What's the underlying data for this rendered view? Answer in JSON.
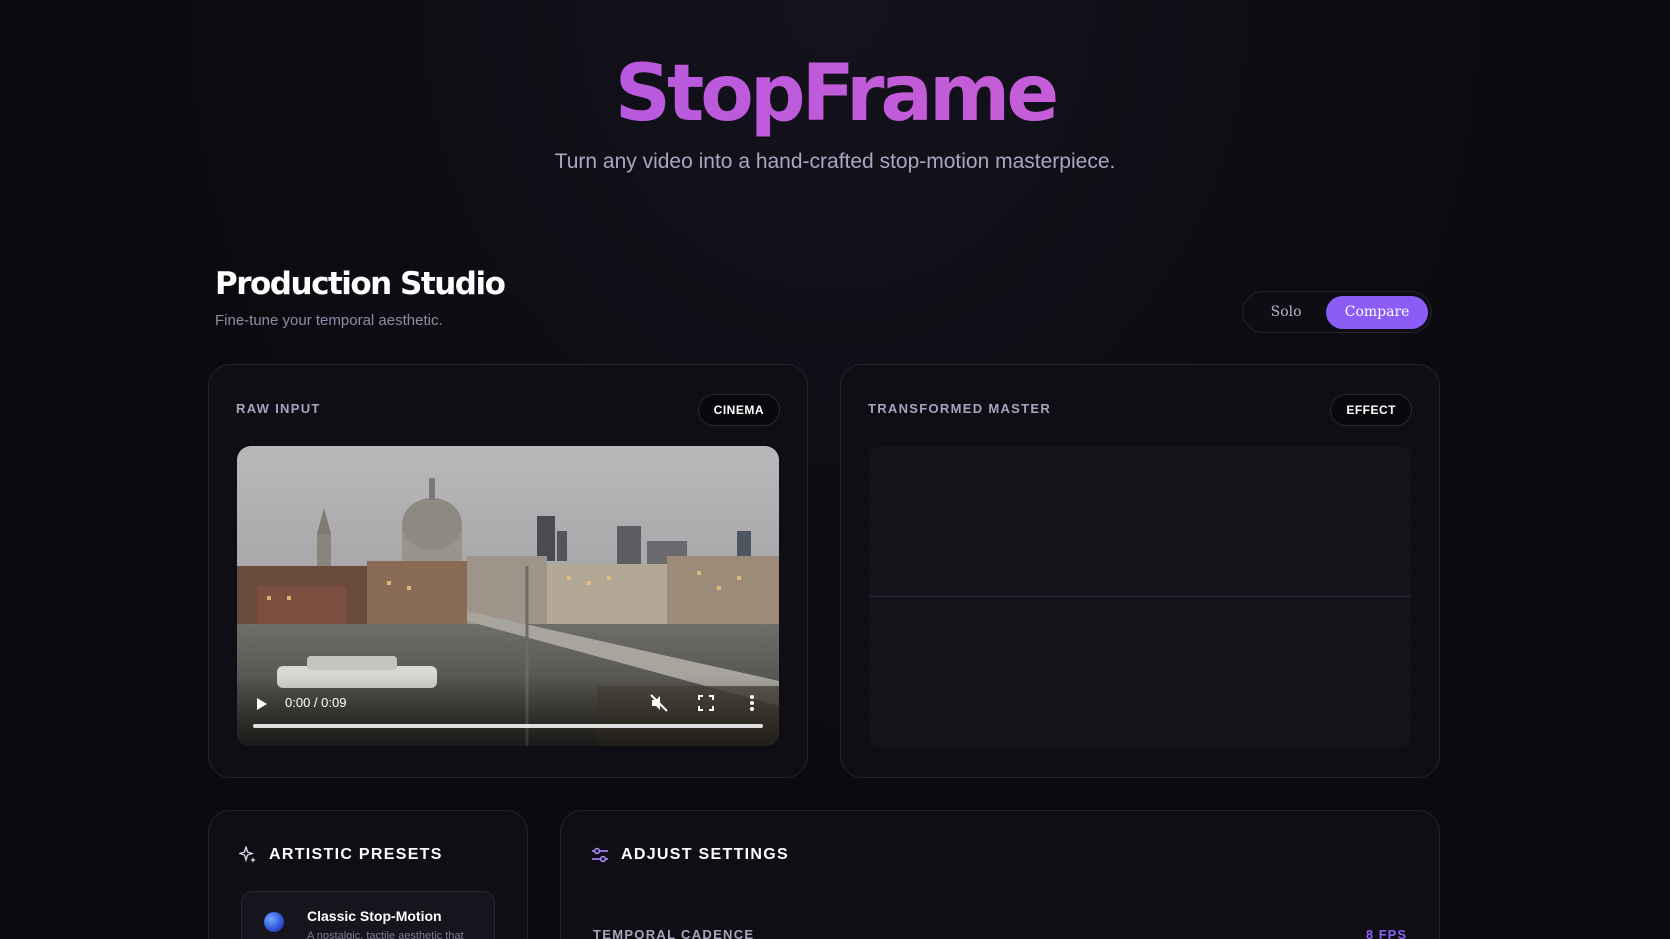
{
  "header": {
    "brand": "StopFrame",
    "tagline": "Turn any video into a hand-crafted stop-motion masterpiece."
  },
  "studio": {
    "title": "Production Studio",
    "subtitle": "Fine-tune your temporal aesthetic.",
    "view_modes": [
      "Solo",
      "Compare"
    ],
    "active_mode": "Compare"
  },
  "panels": {
    "input": {
      "label": "RAW INPUT",
      "badge": "CINEMA",
      "video": {
        "time": "0:00 / 0:09",
        "muted": true
      }
    },
    "output": {
      "label": "TRANSFORMED MASTER",
      "badge": "EFFECT"
    }
  },
  "presets": {
    "title": "ARTISTIC PRESETS",
    "items": [
      {
        "name": "Classic Stop-Motion",
        "description": "A nostalgic, tactile aesthetic that"
      }
    ]
  },
  "settings": {
    "title": "ADJUST SETTINGS",
    "temporal_cadence": {
      "label": "TEMPORAL CADENCE",
      "value": "8 FPS"
    }
  },
  "colors": {
    "accent": "#8b5cf6",
    "brand_start": "#a259e8",
    "brand_end": "#d06ad0"
  }
}
